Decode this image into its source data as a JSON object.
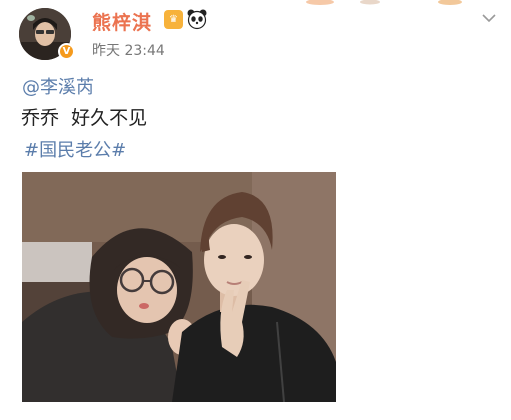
{
  "post": {
    "author": {
      "name": "熊梓淇",
      "verified": true,
      "name_color": "#eb7350",
      "badge_icon": "verified-v-icon",
      "member_icon": "member-crown-icon",
      "emoji_icon": "panda-icon"
    },
    "timestamp": "昨天 23:44",
    "mention": "@李溪芮",
    "text": "乔乔  好久不见",
    "hashtag": "#国民老公#",
    "link_color": "#5b7dab",
    "menu_icon": "chevron-down-icon",
    "image": {
      "description_icon": "photo-image"
    }
  }
}
